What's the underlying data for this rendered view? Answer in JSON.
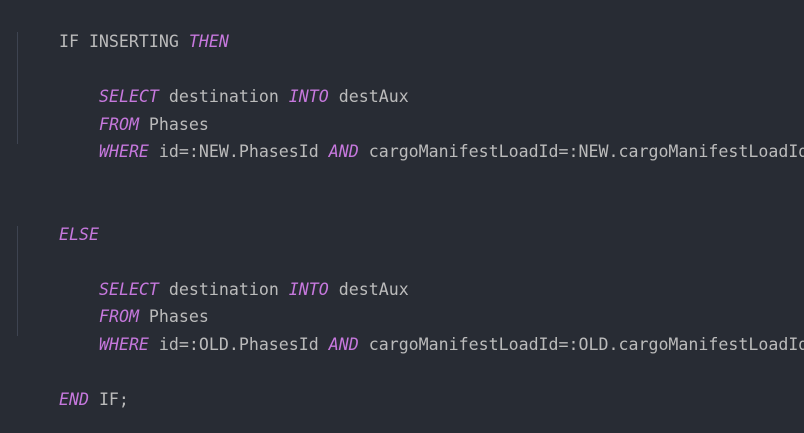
{
  "editor": {
    "background": "#282c34",
    "keyword_color": "#c678dd",
    "text_color": "#bbbbbb",
    "lines": [
      {
        "tokens": [
          {
            "text": "IF INSERTING ",
            "type": "plain"
          },
          {
            "text": "THEN",
            "type": "keyword"
          }
        ]
      },
      {
        "tokens": []
      },
      {
        "tokens": [
          {
            "text": "SELECT",
            "type": "keyword"
          },
          {
            "text": " destination ",
            "type": "plain"
          },
          {
            "text": "INTO",
            "type": "keyword"
          },
          {
            "text": " destAux",
            "type": "plain"
          }
        ]
      },
      {
        "tokens": [
          {
            "text": "FROM",
            "type": "keyword"
          },
          {
            "text": " Phases",
            "type": "plain"
          }
        ]
      },
      {
        "tokens": [
          {
            "text": "WHERE",
            "type": "keyword"
          },
          {
            "text": " id=:NEW.PhasesId ",
            "type": "plain"
          },
          {
            "text": "AND",
            "type": "keyword"
          },
          {
            "text": " cargoManifestLoadId=:NEW.cargoManifestLoadId;",
            "type": "plain"
          }
        ]
      },
      {
        "tokens": []
      },
      {
        "tokens": []
      },
      {
        "tokens": [
          {
            "text": "ELSE",
            "type": "keyword"
          }
        ]
      },
      {
        "tokens": []
      },
      {
        "tokens": [
          {
            "text": "SELECT",
            "type": "keyword"
          },
          {
            "text": " destination ",
            "type": "plain"
          },
          {
            "text": "INTO",
            "type": "keyword"
          },
          {
            "text": " destAux",
            "type": "plain"
          }
        ]
      },
      {
        "tokens": [
          {
            "text": "FROM",
            "type": "keyword"
          },
          {
            "text": " Phases",
            "type": "plain"
          }
        ]
      },
      {
        "tokens": [
          {
            "text": "WHERE",
            "type": "keyword"
          },
          {
            "text": " id=:OLD.PhasesId ",
            "type": "plain"
          },
          {
            "text": "AND",
            "type": "keyword"
          },
          {
            "text": " cargoManifestLoadId=:OLD.cargoManifestLoadId;",
            "type": "plain"
          }
        ]
      },
      {
        "tokens": []
      },
      {
        "tokens": [
          {
            "text": "END",
            "type": "keyword"
          },
          {
            "text": " IF;",
            "type": "plain"
          }
        ]
      }
    ]
  }
}
